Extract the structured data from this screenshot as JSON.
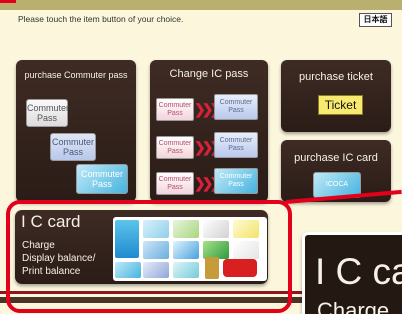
{
  "header": {
    "prompt": "Please touch the item button of your choice.",
    "language_button": "日本語"
  },
  "commuter_panel": {
    "title": "purchase Commuter pass",
    "cards": [
      {
        "line1": "Commuter",
        "line2": "Pass"
      },
      {
        "line1": "Commuter",
        "line2": "Pass"
      },
      {
        "line1": "Commuter",
        "line2": "Pass"
      }
    ]
  },
  "change_panel": {
    "title": "Change IC pass",
    "rows": [
      {
        "from1": "Commuter",
        "from2": "Pass",
        "to1": "Commuter",
        "to2": "Pass"
      },
      {
        "from1": "Commuter",
        "from2": "Pass",
        "to1": "Commuter",
        "to2": "Pass"
      },
      {
        "from1": "Commuter",
        "from2": "Pass",
        "to1": "Commuter",
        "to2": "Pass"
      }
    ],
    "arrow": "❯❯❯"
  },
  "ticket_panel": {
    "title": "purchase ticket",
    "button": "Ticket"
  },
  "ic_card_panel": {
    "title": "purchase IC card",
    "card_text": "ICOCA"
  },
  "ic_card_main": {
    "title": "I C card",
    "line1": "Charge",
    "line2": "Display balance/",
    "line3": "Print balance"
  },
  "zoom_inset": {
    "title": "I C ca",
    "line1": "Charge"
  },
  "colors": {
    "background": "#fbf6dc",
    "panel": "#3e2b24",
    "highlight": "#e3001b",
    "ticket_button": "#f7ea6f"
  }
}
